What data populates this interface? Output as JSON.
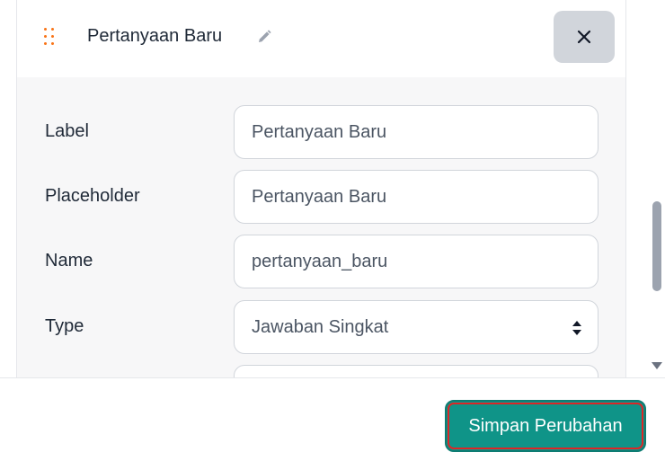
{
  "header": {
    "title": "Pertanyaan Baru",
    "drag_icon": "drag-handle-icon",
    "edit_icon": "pencil-icon",
    "close_icon": "close-icon"
  },
  "form": {
    "label": {
      "label": "Label",
      "value": "Pertanyaan Baru"
    },
    "placeholder": {
      "label": "Placeholder",
      "value": "Pertanyaan Baru"
    },
    "name": {
      "label": "Name",
      "value": "pertanyaan_baru"
    },
    "type": {
      "label": "Type",
      "value": "Jawaban Singkat"
    }
  },
  "footer": {
    "save_label": "Simpan Perubahan"
  },
  "colors": {
    "accent": "#0f9488",
    "drag_handle": "#f97316",
    "focus_outline": "#dc2626"
  }
}
